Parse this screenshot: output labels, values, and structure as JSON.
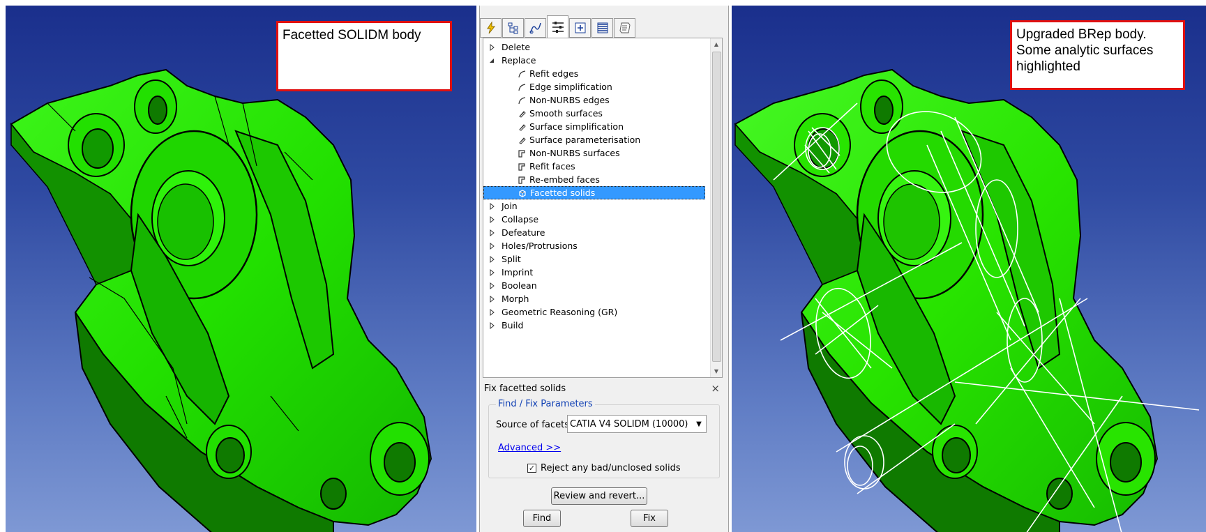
{
  "left_view": {
    "callout": "Facetted SOLIDM body"
  },
  "right_view": {
    "callout": "Upgraded BRep body.\nSome analytic surfaces\nhighlighted"
  },
  "panel": {
    "tabs": [
      "lightning-icon",
      "hierarchy-icon",
      "graph-icon",
      "sliders-icon",
      "add-page-icon",
      "layers-icon",
      "scroll-icon"
    ],
    "tree": [
      {
        "label": "Delete",
        "type": "collapsed"
      },
      {
        "label": "Replace",
        "type": "expanded"
      },
      {
        "label": "Refit edges",
        "type": "child",
        "icon": "edge"
      },
      {
        "label": "Edge simplification",
        "type": "child",
        "icon": "edge"
      },
      {
        "label": "Non-NURBS edges",
        "type": "child",
        "icon": "edge"
      },
      {
        "label": "Smooth surfaces",
        "type": "child",
        "icon": "surface"
      },
      {
        "label": "Surface simplification",
        "type": "child",
        "icon": "surface"
      },
      {
        "label": "Surface parameterisation",
        "type": "child",
        "icon": "surface"
      },
      {
        "label": "Non-NURBS surfaces",
        "type": "child",
        "icon": "face"
      },
      {
        "label": "Refit faces",
        "type": "child",
        "icon": "face"
      },
      {
        "label": "Re-embed faces",
        "type": "child",
        "icon": "face"
      },
      {
        "label": "Facetted solids",
        "type": "child",
        "icon": "solid",
        "selected": true
      },
      {
        "label": "Join",
        "type": "collapsed"
      },
      {
        "label": "Collapse",
        "type": "collapsed"
      },
      {
        "label": "Defeature",
        "type": "collapsed"
      },
      {
        "label": "Holes/Protrusions",
        "type": "collapsed"
      },
      {
        "label": "Split",
        "type": "collapsed"
      },
      {
        "label": "Imprint",
        "type": "collapsed"
      },
      {
        "label": "Boolean",
        "type": "collapsed"
      },
      {
        "label": "Morph",
        "type": "collapsed"
      },
      {
        "label": "Geometric Reasoning (GR)",
        "type": "collapsed"
      },
      {
        "label": "Build",
        "type": "collapsed"
      }
    ],
    "fix": {
      "title": "Fix facetted solids",
      "close": "×",
      "group_title": "Find / Fix Parameters",
      "source_label": "Source of facets",
      "source_value": "CATIA V4 SOLIDM (10000)",
      "advanced_link": "Advanced >>",
      "reject_label": "Reject any bad/unclosed solids",
      "reject_checked": true,
      "review_button": "Review and revert...",
      "find_button": "Find",
      "fix_button": "Fix"
    }
  },
  "colors": {
    "part_green": "#22e000",
    "part_dark": "#0f7a00",
    "selection": "#3399ff",
    "callout_border": "#e01010",
    "link": "#0000ee"
  }
}
